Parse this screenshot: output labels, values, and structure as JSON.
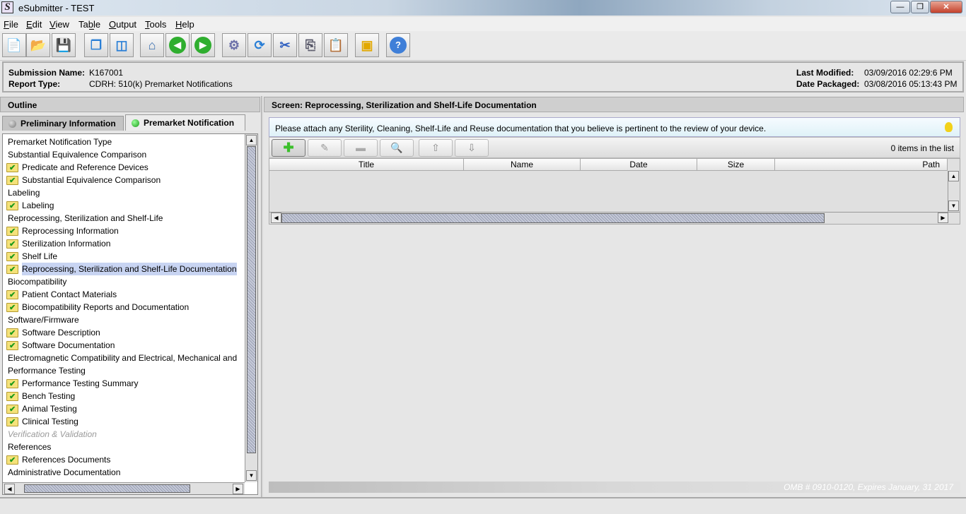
{
  "window": {
    "title": "eSubmitter - TEST",
    "app_icon_letter": "S"
  },
  "menu": [
    "File",
    "Edit",
    "View",
    "Table",
    "Output",
    "Tools",
    "Help"
  ],
  "toolbar": [
    "new-document-icon",
    "open-folder-icon",
    "save-icon",
    "cascade-windows-icon",
    "split-view-icon",
    "home-icon",
    "back-icon",
    "forward-icon",
    "settings-run-icon",
    "refresh-icon",
    "cut-icon",
    "copy-icon",
    "paste-icon",
    "package-icon",
    "help-icon"
  ],
  "info": {
    "submission_name_label": "Submission Name:",
    "submission_name": "K167001",
    "report_type_label": "Report Type:",
    "report_type": "CDRH: 510(k) Premarket Notifications",
    "last_modified_label": "Last Modified:",
    "last_modified": "03/09/2016 02:29:6 PM",
    "date_packaged_label": "Date Packaged:",
    "date_packaged": "03/08/2016 05:13:43 PM"
  },
  "outline": {
    "title": "Outline",
    "tabs": [
      {
        "label": "Preliminary Information",
        "status_color": "#8a8a8a"
      },
      {
        "label": "Premarket Notification",
        "status_color": "#2fb82f"
      }
    ],
    "items": [
      {
        "label": "Premarket Notification Type",
        "type": "section"
      },
      {
        "label": "Substantial Equivalence Comparison",
        "type": "section"
      },
      {
        "label": "Predicate and Reference Devices",
        "type": "doc"
      },
      {
        "label": "Substantial Equivalence Comparison",
        "type": "doc"
      },
      {
        "label": "Labeling",
        "type": "section"
      },
      {
        "label": "Labeling",
        "type": "doc"
      },
      {
        "label": "Reprocessing, Sterilization and Shelf-Life",
        "type": "section"
      },
      {
        "label": "Reprocessing Information",
        "type": "doc"
      },
      {
        "label": "Sterilization Information",
        "type": "doc"
      },
      {
        "label": "Shelf Life",
        "type": "doc"
      },
      {
        "label": "Reprocessing, Sterilization and Shelf-Life Documentation",
        "type": "doc",
        "selected": true
      },
      {
        "label": "Biocompatibility",
        "type": "section"
      },
      {
        "label": "Patient Contact Materials",
        "type": "doc"
      },
      {
        "label": "Biocompatibility Reports and Documentation",
        "type": "doc"
      },
      {
        "label": "Software/Firmware",
        "type": "section"
      },
      {
        "label": "Software Description",
        "type": "doc"
      },
      {
        "label": "Software Documentation",
        "type": "doc"
      },
      {
        "label": "Electromagnetic Compatibility and Electrical, Mechanical and",
        "type": "section"
      },
      {
        "label": "Performance Testing",
        "type": "section"
      },
      {
        "label": "Performance Testing Summary",
        "type": "doc"
      },
      {
        "label": "Bench Testing",
        "type": "doc"
      },
      {
        "label": "Animal Testing",
        "type": "doc"
      },
      {
        "label": "Clinical Testing",
        "type": "doc"
      },
      {
        "label": "Verification & Validation",
        "type": "disabled"
      },
      {
        "label": "References",
        "type": "section"
      },
      {
        "label": "References Documents",
        "type": "doc"
      },
      {
        "label": "Administrative Documentation",
        "type": "section"
      }
    ]
  },
  "screen": {
    "title": "Screen: Reprocessing, Sterilization and Shelf-Life Documentation",
    "hint": "Please attach any Sterility, Cleaning, Shelf-Life and Reuse documentation that you believe is pertinent to the review of your device.",
    "list_buttons": [
      "add-icon",
      "edit-icon",
      "remove-icon",
      "view-icon",
      "move-up-icon",
      "move-down-icon"
    ],
    "count": "0 items in the list",
    "columns": [
      "Title",
      "Name",
      "Date",
      "Size",
      "Path"
    ],
    "rows": []
  },
  "footer": {
    "omb": "OMB # 0910-0120, Expires January, 31 2017"
  }
}
